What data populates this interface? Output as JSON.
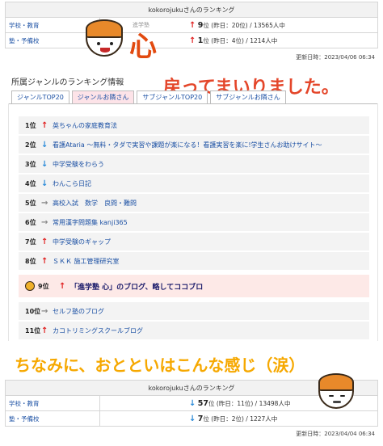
{
  "top_box": {
    "header": "kokorojukuさんのランキング",
    "rows": [
      {
        "category": "学校・教育",
        "rank": "9",
        "detail": "位 (昨日：20位) / 13565人中",
        "arrow": "up"
      },
      {
        "category": "塾・予備校",
        "rank": "1",
        "detail": "位 (昨日：4位) / 1214人中",
        "arrow": "up"
      }
    ],
    "updated": "更新日時：2023/04/06 06:34"
  },
  "overlay": {
    "shingaku_label": "進学塾",
    "kokoro_char": "心",
    "back_text": "戻ってまいりました。",
    "ototoi_text": "ちなみに、おとといはこんな感じ（涙）"
  },
  "genre": {
    "title": "所属ジャンルのランキング情報",
    "tabs": [
      "ジャンルTOP20",
      "ジャンルお隣さん",
      "サブジャンルTOP20",
      "サブジャンルお隣さん"
    ],
    "active_tab": 1,
    "items": [
      {
        "rank": "1位",
        "arrow": "up",
        "title": "英ちゃんの家庭教育法"
      },
      {
        "rank": "2位",
        "arrow": "down",
        "title": "看護Ataria ～無料・タダで実習や課題が楽になる！看護実習を楽に!学生さんお助けサイト～"
      },
      {
        "rank": "3位",
        "arrow": "down",
        "title": "中学受験をわらう"
      },
      {
        "rank": "4位",
        "arrow": "down",
        "title": "わんこら日記"
      },
      {
        "rank": "5位",
        "arrow": "right",
        "title": "高校入試　数学　良問・難問"
      },
      {
        "rank": "6位",
        "arrow": "right",
        "title": "常用漢字問題集 kanji365"
      },
      {
        "rank": "7位",
        "arrow": "up",
        "title": "中学受験のギャップ"
      },
      {
        "rank": "8位",
        "arrow": "up",
        "title": "ＳＫＫ 施工管理研究室"
      },
      {
        "rank": "9位",
        "arrow": "up",
        "title": "「進学塾 心」のブログ、略してココブロ",
        "self": true
      },
      {
        "rank": "10位",
        "arrow": "right",
        "title": "セルフ塾のブログ"
      },
      {
        "rank": "11位",
        "arrow": "up",
        "title": "カコトリミングスクールブログ"
      }
    ]
  },
  "bottom_box": {
    "header": "kokorojukuさんのランキング",
    "rows": [
      {
        "category": "学校・教育",
        "rank": "57",
        "detail": "位 (昨日：11位) / 13498人中",
        "arrow": "down"
      },
      {
        "category": "塾・予備校",
        "rank": "7",
        "detail": "位 (昨日：2位) / 1227人中",
        "arrow": "down"
      }
    ],
    "updated": "更新日時：2023/04/04 06:34"
  },
  "arrows": {
    "up": "🡅",
    "down": "🡇",
    "right": "🡆"
  },
  "colors": {
    "accent_red": "#e02020",
    "accent_blue": "#2a8ad8",
    "link": "#1a4fa3",
    "kokoro_orange": "#e24a10",
    "caption_yellow": "#f6a800"
  }
}
